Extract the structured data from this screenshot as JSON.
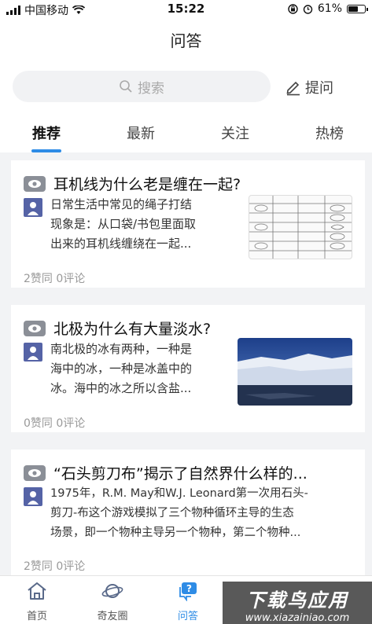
{
  "status_bar": {
    "carrier": "中国移动",
    "time": "15:22",
    "battery": "61%",
    "battery_level": 0.61
  },
  "header": {
    "title": "问答",
    "search_placeholder": "搜索",
    "ask_label": "提问"
  },
  "tabs": [
    {
      "label": "推荐",
      "active": true
    },
    {
      "label": "最新",
      "active": false
    },
    {
      "label": "关注",
      "active": false
    },
    {
      "label": "热榜",
      "active": false
    }
  ],
  "cards": [
    {
      "title": "耳机线为什么老是缠在一起?",
      "excerpt_lines": [
        "日常生活中常见的绳子打结",
        "现象是：从口袋/书包里面取",
        "出来的耳机线缠绕在一起..."
      ],
      "stats": "2赞同 0评论",
      "thumb": "knot-diagram"
    },
    {
      "title": "北极为什么有大量淡水?",
      "excerpt_lines": [
        "南北极的冰有两种，一种是",
        "海中的冰，一种是冰盖中的",
        "冰。海中的冰之所以含盐..."
      ],
      "stats": "0赞同 0评论",
      "thumb": "glacier-photo"
    },
    {
      "title": "“石头剪刀布”揭示了自然界什么样的...",
      "excerpt_lines": [
        "1975年，R.M. May和W.J. Leonard第一次用石头-",
        "剪刀-布这个游戏模拟了三个物种循环主导的生态",
        "场景，即一个物种主导另一个物种，第二个物种..."
      ],
      "stats": "2赞同 0评论",
      "thumb": ""
    }
  ],
  "bottom_nav": [
    {
      "label": "首页",
      "icon": "home-icon",
      "active": false
    },
    {
      "label": "奇友圈",
      "icon": "planet-icon",
      "active": false
    },
    {
      "label": "问答",
      "icon": "qa-icon",
      "active": true
    }
  ],
  "watermark": {
    "main": "下载鸟应用",
    "sub": "www.xiazainiao.com"
  },
  "colors": {
    "accent": "#2e8ce6",
    "background": "#f2f3f5",
    "avatar": "#5563a6",
    "badge": "#8b8f97"
  }
}
